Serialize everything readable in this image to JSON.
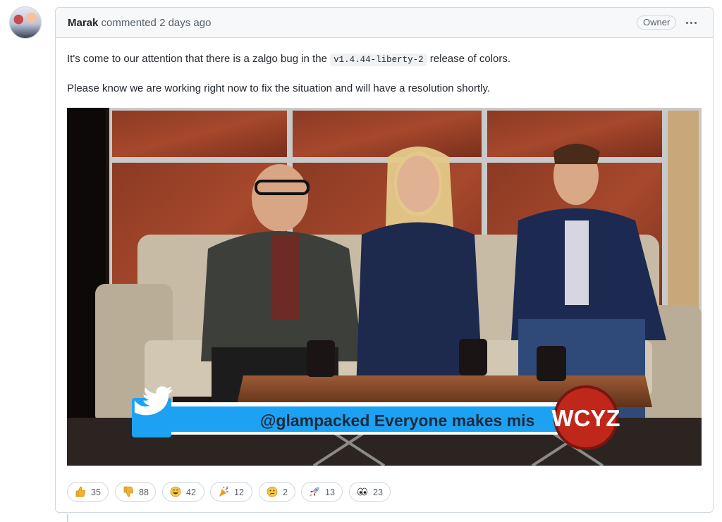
{
  "comment": {
    "author": "Marak",
    "action_text": "commented 2 days ago",
    "badge": "Owner",
    "paragraph1_before": "It's come to our attention that there is a zalgo bug in the",
    "version_code": "v1.4.44-liberty-2",
    "paragraph1_after": "release of colors.",
    "paragraph2": "Please know we are working right now to fix the situation and will have a resolution shortly."
  },
  "image": {
    "ticker_text": "@glampacked Everyone makes mis",
    "station_logo": "WCYZ",
    "ticker_icon": "twitter-bird-icon"
  },
  "reactions": [
    {
      "name": "thumbs-up",
      "count": "35"
    },
    {
      "name": "thumbs-down",
      "count": "88"
    },
    {
      "name": "laugh",
      "count": "42"
    },
    {
      "name": "hooray",
      "count": "12"
    },
    {
      "name": "confused",
      "count": "2"
    },
    {
      "name": "rocket",
      "count": "13"
    },
    {
      "name": "eyes",
      "count": "23"
    }
  ],
  "colors": {
    "accent_blue": "#1da1f2",
    "logo_red": "#c0271b",
    "border": "#d0d7de"
  }
}
